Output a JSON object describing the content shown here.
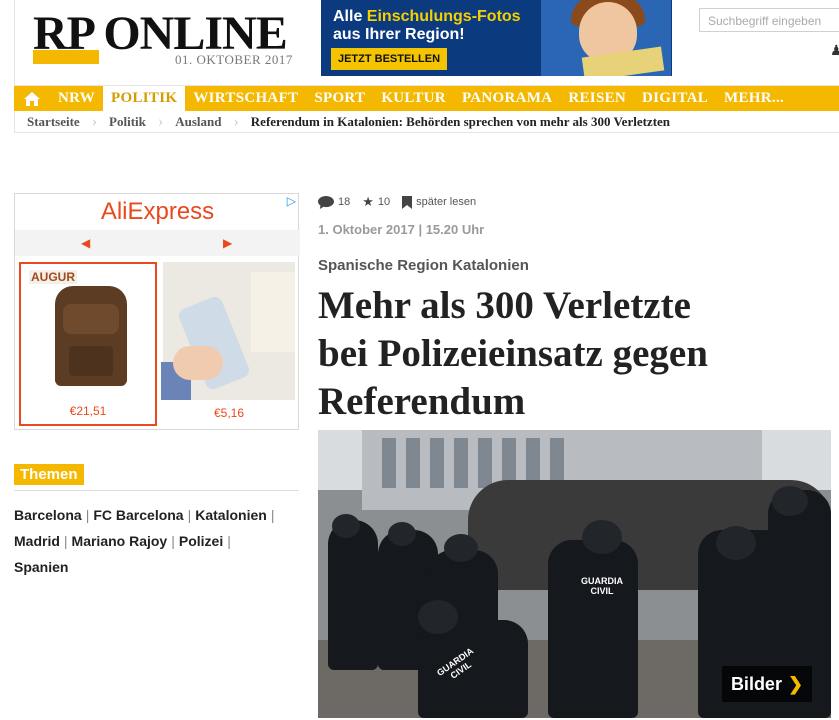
{
  "header": {
    "logo": "RP ONLINE",
    "date": "01. OKTOBER 2017",
    "promo": {
      "line1_prefix": "Alle ",
      "line1_highlight": "Einschulungs-Fotos",
      "line2": "aus Ihrer Region!",
      "button": "JETZT BESTELLEN"
    },
    "search_placeholder": "Suchbegriff eingeben",
    "user_label": "a"
  },
  "nav": {
    "items": [
      "NRW",
      "POLITIK",
      "WIRTSCHAFT",
      "SPORT",
      "KULTUR",
      "PANORAMA",
      "REISEN",
      "DIGITAL",
      "MEHR..."
    ],
    "active": "POLITIK"
  },
  "breadcrumb": {
    "items": [
      "Startseite",
      "Politik",
      "Ausland",
      "Referendum in Katalonien: Behörden sprechen von mehr als 300 Verletzten"
    ]
  },
  "ad": {
    "brand": "AliExpress",
    "card1_brand": "AUGUR",
    "card1_price": "€21,51",
    "card2_price": "€5,16"
  },
  "themen": {
    "title": "Themen",
    "tags": [
      "Barcelona",
      "FC Barcelona",
      "Katalonien",
      "Madrid",
      "Mariano Rajoy",
      "Polizei",
      "Spanien"
    ]
  },
  "article": {
    "comments": "18",
    "stars": "10",
    "read_later": "später lesen",
    "date": "1. Oktober 2017 | 15.20 Uhr",
    "kicker": "Spanische Region Katalonien",
    "headline_lines": [
      "Mehr als 300 Verletzte",
      "bei Polizeieinsatz gegen",
      "Referendum"
    ],
    "gallery_button": "Bilder",
    "vest_label_line1": "GUARDIA",
    "vest_label_line2": "CIVIL"
  },
  "colors": {
    "brand_yellow": "#f5b800",
    "aliexpress_orange": "#e8491d"
  }
}
